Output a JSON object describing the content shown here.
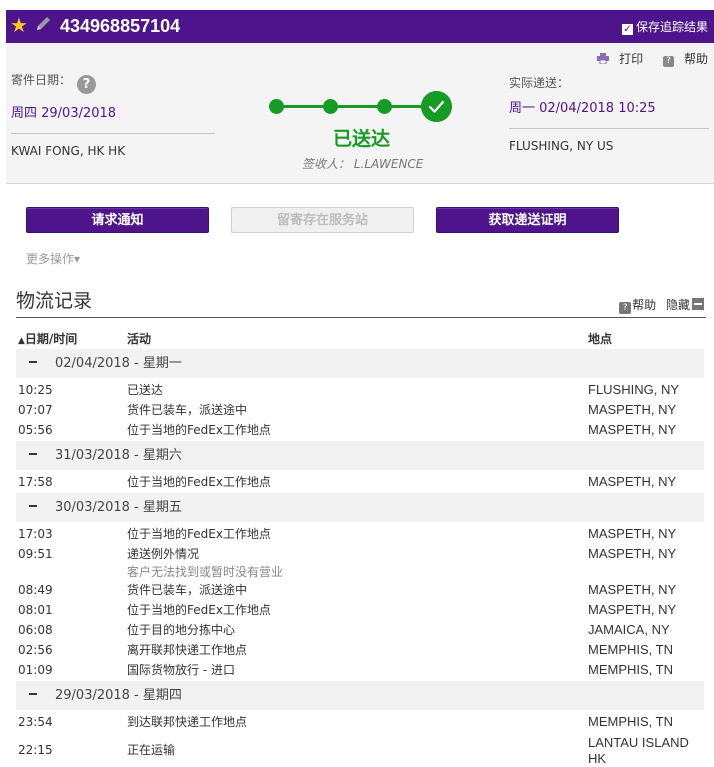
{
  "header": {
    "tracking_number": "434968857104",
    "save_label": "保存追踪结果",
    "star_icon": "star-icon",
    "edit_icon": "pencil-icon"
  },
  "tools": {
    "print": "打印",
    "help": "帮助"
  },
  "ship": {
    "label": "寄件日期：",
    "date": "周四 29/03/2018",
    "location": "KWAI FONG, HK HK"
  },
  "delivery": {
    "label": "实际递送：",
    "date": "周一 02/04/2018 10:25",
    "location": "FLUSHING, NY US"
  },
  "status": {
    "text": "已送达",
    "signed_by": "签收人： L.LAWENCE"
  },
  "buttons": {
    "notify": "请求通知",
    "hold": "留寄存在服务站",
    "proof": "获取递送证明"
  },
  "more_actions": "更多操作",
  "history": {
    "title": "物流记录",
    "help": "帮助",
    "hide": "隐藏",
    "columns": {
      "date": "日期/时间",
      "activity": "活动",
      "location": "地点"
    },
    "days": [
      {
        "date": "02/04/2018 - 星期一",
        "events": [
          {
            "time": "10:25",
            "activity": "已送达",
            "location": "FLUSHING, NY"
          },
          {
            "time": "07:07",
            "activity": "货件已装车，派送途中",
            "location": "MASPETH, NY"
          },
          {
            "time": "05:56",
            "activity": "位于当地的FedEx工作地点",
            "location": "MASPETH, NY"
          }
        ]
      },
      {
        "date": "31/03/2018 - 星期六",
        "events": [
          {
            "time": "17:58",
            "activity": "位于当地的FedEx工作地点",
            "location": "MASPETH, NY"
          }
        ]
      },
      {
        "date": "30/03/2018 - 星期五",
        "events": [
          {
            "time": "17:03",
            "activity": "位于当地的FedEx工作地点",
            "location": "MASPETH, NY"
          },
          {
            "time": "09:51",
            "activity": "递送例外情况",
            "sub": "客户无法找到或暂时没有营业",
            "location": "MASPETH, NY"
          },
          {
            "time": "08:49",
            "activity": "货件已装车，派送途中",
            "location": "MASPETH, NY"
          },
          {
            "time": "08:01",
            "activity": "位于当地的FedEx工作地点",
            "location": "MASPETH, NY"
          },
          {
            "time": "06:08",
            "activity": "位于目的地分拣中心",
            "location": "JAMAICA, NY"
          },
          {
            "time": "02:56",
            "activity": "离开联邦快递工作地点",
            "location": "MEMPHIS, TN"
          },
          {
            "time": "01:09",
            "activity": "国际货物放行 - 进口",
            "location": "MEMPHIS, TN"
          }
        ]
      },
      {
        "date": "29/03/2018 - 星期四",
        "events": [
          {
            "time": "23:54",
            "activity": "到达联邦快递工作地点",
            "location": "MEMPHIS, TN"
          },
          {
            "time": "22:15",
            "activity": "正在运输",
            "location": "LANTAU ISLAND HK"
          }
        ]
      }
    ]
  }
}
